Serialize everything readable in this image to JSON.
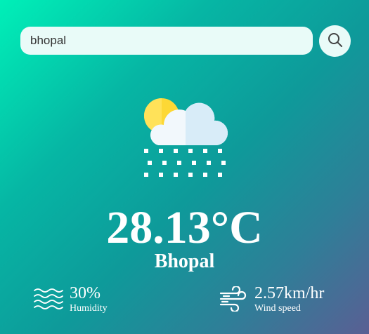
{
  "search": {
    "value": "bhopal"
  },
  "weather": {
    "temperature": "28.13°C",
    "city": "Bhopal",
    "condition_icon": "snow-cloud-sun-icon"
  },
  "humidity": {
    "value": "30%",
    "label": "Humidity",
    "icon": "humidity-waves-icon"
  },
  "wind": {
    "value": "2.57km/hr",
    "label": "Wind speed",
    "icon": "wind-icon"
  },
  "colors": {
    "gradient_start": "#00f0b8",
    "gradient_end": "#5a5f94",
    "input_bg": "#e9fbf8",
    "text": "#ffffff"
  }
}
